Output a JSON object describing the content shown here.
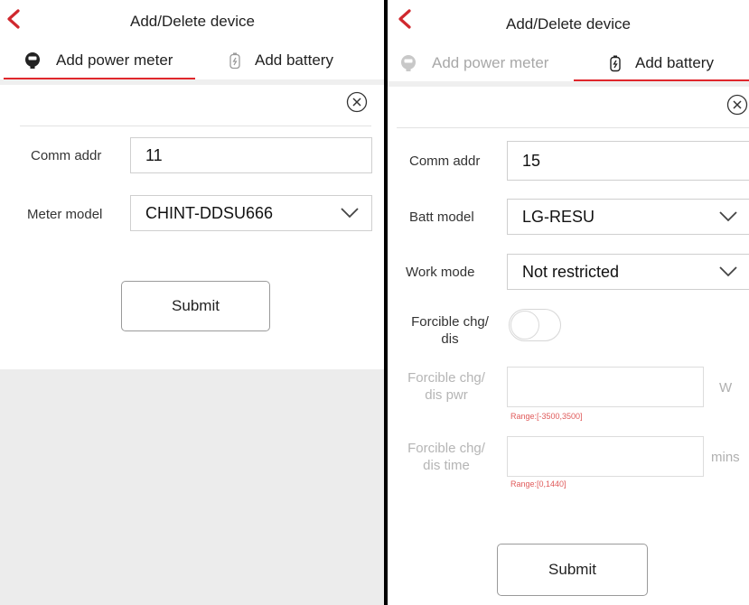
{
  "left": {
    "title": "Add/Delete device",
    "tabs": [
      {
        "label": "Add power meter",
        "active": true
      },
      {
        "label": "Add battery",
        "active": false
      }
    ],
    "form": {
      "comm_addr_label": "Comm addr",
      "comm_addr_value": "11",
      "meter_model_label": "Meter model",
      "meter_model_value": "CHINT-DDSU666"
    },
    "submit_label": "Submit"
  },
  "right": {
    "title": "Add/Delete device",
    "tabs": [
      {
        "label": "Add power meter",
        "active": false
      },
      {
        "label": "Add battery",
        "active": true
      }
    ],
    "form": {
      "comm_addr_label": "Comm addr",
      "comm_addr_value": "15",
      "batt_model_label": "Batt model",
      "batt_model_value": "LG-RESU",
      "work_mode_label": "Work mode",
      "work_mode_value": "Not restricted",
      "forcible_label_1": "Forcible chg/",
      "forcible_label_2": "dis",
      "forcible_on": false,
      "pwr_label_1": "Forcible chg/",
      "pwr_label_2": "dis pwr",
      "pwr_unit": "W",
      "pwr_range": "Range:[-3500,3500]",
      "time_label_1": "Forcible chg/",
      "time_label_2": "dis time",
      "time_unit": "mins",
      "time_range": "Range:[0,1440]"
    },
    "submit_label": "Submit"
  },
  "colors": {
    "accent": "#e0272c",
    "background_grey": "#ececec"
  }
}
